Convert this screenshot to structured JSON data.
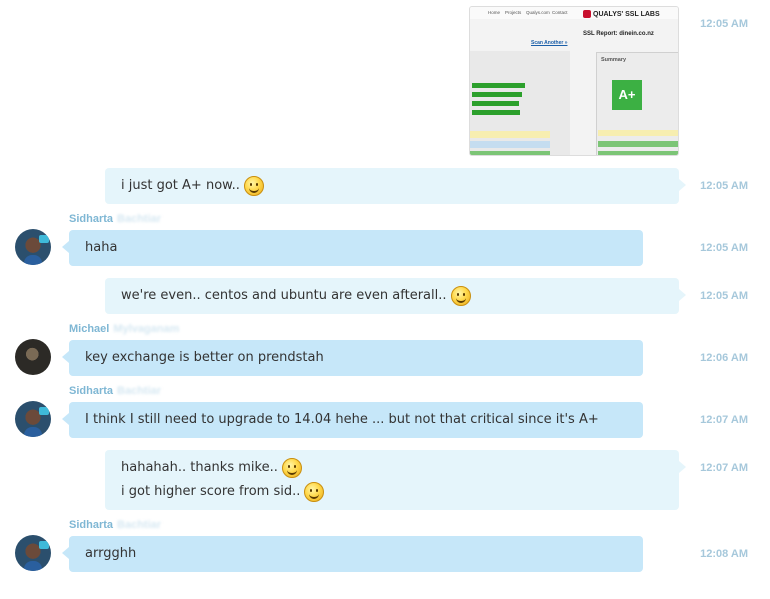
{
  "thumbnail": {
    "nav": [
      "Home",
      "Projects",
      "Qualys.com",
      "Contact"
    ],
    "brand": "QUALYS' SSL LABS",
    "report": "SSL Report: dinein.co.nz",
    "scan_another": "Scan Another »",
    "summary": "Summary",
    "grade": "A+"
  },
  "messages": [
    {
      "time": "12:05 AM"
    },
    {
      "text": "i just got A+ now..",
      "time": "12:05 AM"
    },
    {
      "sender": "Sidharta",
      "sender_last": "Bachtiar",
      "text": "haha",
      "time": "12:05 AM"
    },
    {
      "text": "we're even.. centos and ubuntu are even afterall..",
      "time": "12:05 AM"
    },
    {
      "sender": "Michael",
      "sender_last": "Mylvaganam",
      "text": "key exchange is better on prendstah",
      "time": "12:06 AM"
    },
    {
      "sender": "Sidharta",
      "sender_last": "Bachtiar",
      "text": "I think I still need to upgrade to 14.04 hehe ... but not that critical since it's A+",
      "time": "12:07 AM"
    },
    {
      "lines": [
        "hahahah.. thanks mike..",
        "i got higher score from sid.."
      ],
      "time": "12:07 AM"
    },
    {
      "sender": "Sidharta",
      "sender_last": "Bachtiar",
      "text": "arrgghh",
      "time": "12:08 AM"
    }
  ]
}
